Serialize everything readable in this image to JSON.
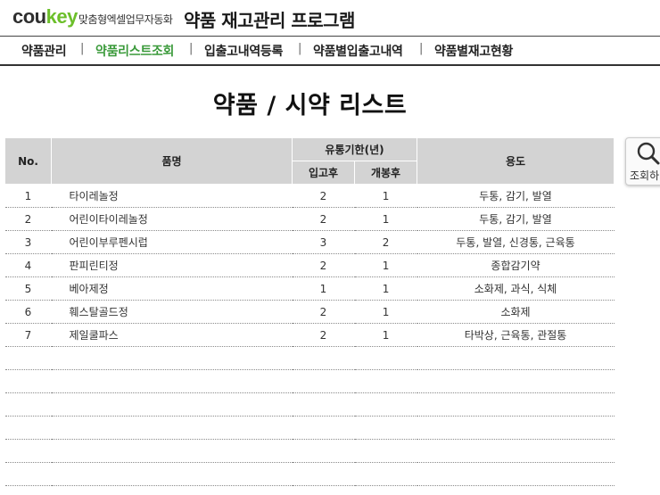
{
  "header": {
    "logo_part1": "cou",
    "logo_part2": "key",
    "tagline": "맞춤형엑셀업무자동화",
    "app_title": "약품 재고관리 프로그램"
  },
  "menu": [
    {
      "label": "약품관리",
      "active": false
    },
    {
      "label": "약품리스트조회",
      "active": true
    },
    {
      "label": "입출고내역등록",
      "active": false
    },
    {
      "label": "약품별입출고내역",
      "active": false
    },
    {
      "label": "약품별재고현황",
      "active": false
    }
  ],
  "menu_separator": "|",
  "page_title": "약품 / 시약 리스트",
  "search_button": {
    "label": "조회하기",
    "icon": "search-icon"
  },
  "table": {
    "headers": {
      "no": "No.",
      "name": "품명",
      "expiry_group": "유통기한(년)",
      "expiry_in": "입고후",
      "expiry_open": "개봉후",
      "usage": "용도"
    },
    "rows": [
      {
        "no": "1",
        "name": "타이레놀정",
        "in": "2",
        "open": "1",
        "usage": "두통, 감기, 발열"
      },
      {
        "no": "2",
        "name": "어린이타이레놀정",
        "in": "2",
        "open": "1",
        "usage": "두통, 감기, 발열"
      },
      {
        "no": "3",
        "name": "어린이부루펜시럽",
        "in": "3",
        "open": "2",
        "usage": "두통, 발열, 신경통, 근육통"
      },
      {
        "no": "4",
        "name": "판피린티정",
        "in": "2",
        "open": "1",
        "usage": "종합감기약"
      },
      {
        "no": "5",
        "name": "베아제정",
        "in": "1",
        "open": "1",
        "usage": "소화제, 과식, 식체"
      },
      {
        "no": "6",
        "name": "훼스탈골드정",
        "in": "2",
        "open": "1",
        "usage": "소화제"
      },
      {
        "no": "7",
        "name": "제일쿨파스",
        "in": "2",
        "open": "1",
        "usage": "타박상, 근육통, 관절통"
      },
      {
        "no": "",
        "name": "",
        "in": "",
        "open": "",
        "usage": ""
      },
      {
        "no": "",
        "name": "",
        "in": "",
        "open": "",
        "usage": ""
      },
      {
        "no": "",
        "name": "",
        "in": "",
        "open": "",
        "usage": ""
      },
      {
        "no": "",
        "name": "",
        "in": "",
        "open": "",
        "usage": ""
      },
      {
        "no": "",
        "name": "",
        "in": "",
        "open": "",
        "usage": ""
      },
      {
        "no": "",
        "name": "",
        "in": "",
        "open": "",
        "usage": ""
      }
    ]
  },
  "colors": {
    "accent": "#3a9a3a",
    "logo_green": "#6cbf2a",
    "header_fill": "#d3d3d3"
  }
}
